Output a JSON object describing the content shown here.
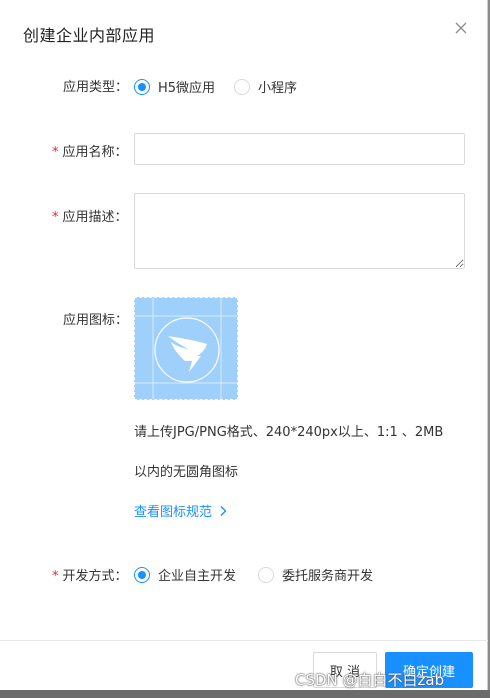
{
  "dialog": {
    "title": "创建企业内部应用",
    "close_glyph": "×"
  },
  "form": {
    "type": {
      "label": "应用类型：",
      "options": [
        {
          "label": "H5微应用",
          "selected": true
        },
        {
          "label": "小程序",
          "selected": false
        }
      ]
    },
    "name": {
      "required_mark": "*",
      "label": "应用名称：",
      "value": "",
      "placeholder": ""
    },
    "description": {
      "required_mark": "*",
      "label": "应用描述：",
      "value": "",
      "placeholder": ""
    },
    "icon": {
      "label": "应用图标：",
      "default_icon": "dingtalk-logo-icon",
      "hint_line1": "请上传JPG/PNG格式、240*240px以上、1:1 、2MB",
      "hint_line2": "以内的无圆角图标",
      "spec_link": "查看图标规范",
      "spec_link_glyph": "chevron-right-icon"
    },
    "dev_mode": {
      "required_mark": "*",
      "label": "开发方式：",
      "options": [
        {
          "label": "企业自主开发",
          "selected": true
        },
        {
          "label": "委托服务商开发",
          "selected": false
        }
      ]
    }
  },
  "footer": {
    "cancel_label": "取 消",
    "ok_label": "确定创建"
  },
  "watermark": "CSDN @白白不白zab",
  "colors": {
    "primary": "#1890ff",
    "required": "#f5222d",
    "icon_bg": "#9fd0fb"
  }
}
